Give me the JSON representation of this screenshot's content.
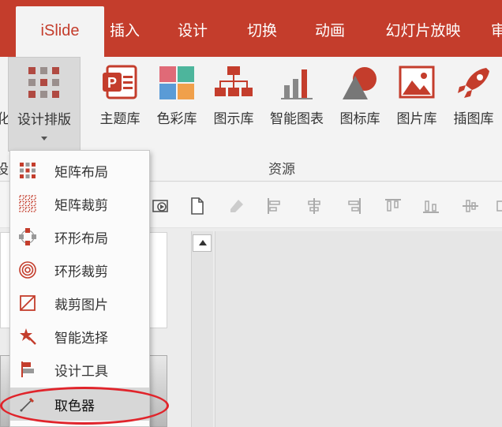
{
  "tabs": [
    {
      "label": "iSlide",
      "active": true
    },
    {
      "label": "插入"
    },
    {
      "label": "设计"
    },
    {
      "label": "切换"
    },
    {
      "label": "动画"
    },
    {
      "label": "幻灯片放映"
    },
    {
      "label": "审"
    }
  ],
  "ribbon": {
    "design_layout_label": "设计排版",
    "cut_left_label": "化",
    "cut_left_label2": "设",
    "resources_group_label": "资源",
    "buttons": [
      {
        "label": "主题库",
        "icon": "theme-library-icon"
      },
      {
        "label": "色彩库",
        "icon": "color-library-icon"
      },
      {
        "label": "图示库",
        "icon": "diagram-library-icon"
      },
      {
        "label": "智能图表",
        "icon": "smart-chart-icon"
      },
      {
        "label": "图标库",
        "icon": "icon-library-icon"
      },
      {
        "label": "图片库",
        "icon": "picture-library-icon"
      },
      {
        "label": "插图库",
        "icon": "illustration-library-icon"
      }
    ]
  },
  "menu": {
    "items": [
      {
        "label": "矩阵布局",
        "icon": "matrix-layout-icon"
      },
      {
        "label": "矩阵裁剪",
        "icon": "matrix-crop-icon"
      },
      {
        "label": "环形布局",
        "icon": "ring-layout-icon"
      },
      {
        "label": "环形裁剪",
        "icon": "ring-crop-icon"
      },
      {
        "label": "裁剪图片",
        "icon": "crop-image-icon"
      },
      {
        "label": "智能选择",
        "icon": "smart-select-icon"
      },
      {
        "label": "设计工具",
        "icon": "design-tools-icon"
      },
      {
        "label": "取色器",
        "icon": "color-picker-icon",
        "highlighted": true
      }
    ]
  },
  "colors": {
    "brand": "#c43d2c",
    "highlight_ring": "#e0242b"
  }
}
